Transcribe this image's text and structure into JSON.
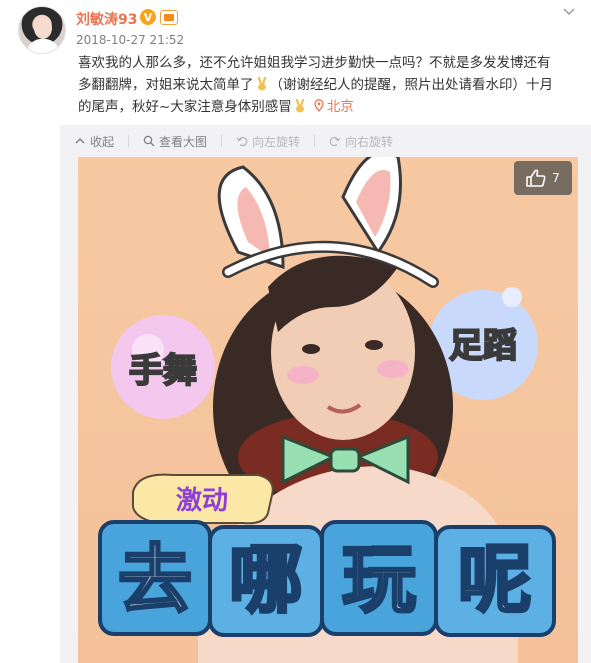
{
  "post": {
    "author": "刘敏涛93",
    "timestamp": "2018-10-27 21:52",
    "verified_badge": "V",
    "lines": [
      "喜欢我的人那么多，还不允许姐姐我学习进步勤快一点吗？不就是多发发博还有",
      "多翻翻牌，对姐来说太简单了",
      "（谢谢经纪人的提醒，照片出处请看水印）十月",
      "的尾声，秋好~大家注意身体别感冒"
    ],
    "location": "北京"
  },
  "toolbar": {
    "collapse": "收起",
    "view_large": "查看大图",
    "rotate_left": "向左旋转",
    "rotate_right": "向右旋转"
  },
  "image": {
    "like_count": "7",
    "sticker_left": "手舞",
    "sticker_right": "足蹈",
    "caption_small": "激动",
    "caption_big": [
      "去",
      "哪",
      "玩",
      "呢"
    ]
  },
  "colors": {
    "accent": "#eb7350",
    "link_gray": "#808080",
    "image_bg": "#f6c9a3",
    "bubble_pink": "#f4c7ef",
    "bubble_blue": "#c9d9fb",
    "banner_blue": "#4aa4dc",
    "bow_green": "#98dfb1"
  },
  "icons": [
    "avatar",
    "verified-icon",
    "level-icon",
    "chevron-down-icon",
    "victory-hand-icon",
    "location-pin-icon",
    "collapse-icon",
    "zoom-icon",
    "rotate-left-icon",
    "rotate-right-icon",
    "thumbs-up-icon"
  ]
}
